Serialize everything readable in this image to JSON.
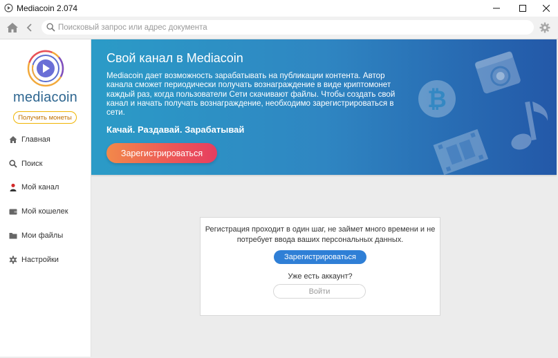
{
  "window": {
    "title": "Mediacoin 2.074"
  },
  "toolbar": {
    "search_placeholder": "Поисковый запрос или адрес документа",
    "search_value": ""
  },
  "sidebar": {
    "brand": "mediacoin",
    "get_coins_label": "Получить монеты",
    "items": [
      {
        "label": "Главная",
        "icon": "home-icon"
      },
      {
        "label": "Поиск",
        "icon": "search-icon"
      },
      {
        "label": "Мой канал",
        "icon": "user-icon"
      },
      {
        "label": "Мой кошелек",
        "icon": "wallet-icon"
      },
      {
        "label": "Мои файлы",
        "icon": "folder-icon"
      },
      {
        "label": "Настройки",
        "icon": "gear-icon"
      }
    ]
  },
  "banner": {
    "title": "Свой канал в Mediacoin",
    "text": "Mediacoin дает возможность зарабатывать на публикации контента. Автор канала сможет периодически получать вознаграждение в виде криптомонет каждый раз, когда пользователи Сети скачивают файлы. Чтобы создать свой канал и начать получать вознаграждение, необходимо зарегистрироваться в сети.",
    "tagline": "Качай. Раздавай. Зарабатывай",
    "button_label": "Зарегистрироваться"
  },
  "card": {
    "text": "Регистрация проходит в один шаг, не займет много времени и не потребует ввода ваших персональных данных.",
    "register_label": "Зарегистрироваться",
    "question": "Уже есть аккаунт?",
    "login_label": "Войти"
  },
  "colors": {
    "brand_blue": "#2e6690",
    "banner_start": "#2b9bc7",
    "banner_end": "#2358a8",
    "cta_gradient_start": "#f2894a",
    "cta_gradient_end": "#e63e60",
    "primary_button": "#2f7fd6",
    "coins_border": "#f0b400"
  }
}
